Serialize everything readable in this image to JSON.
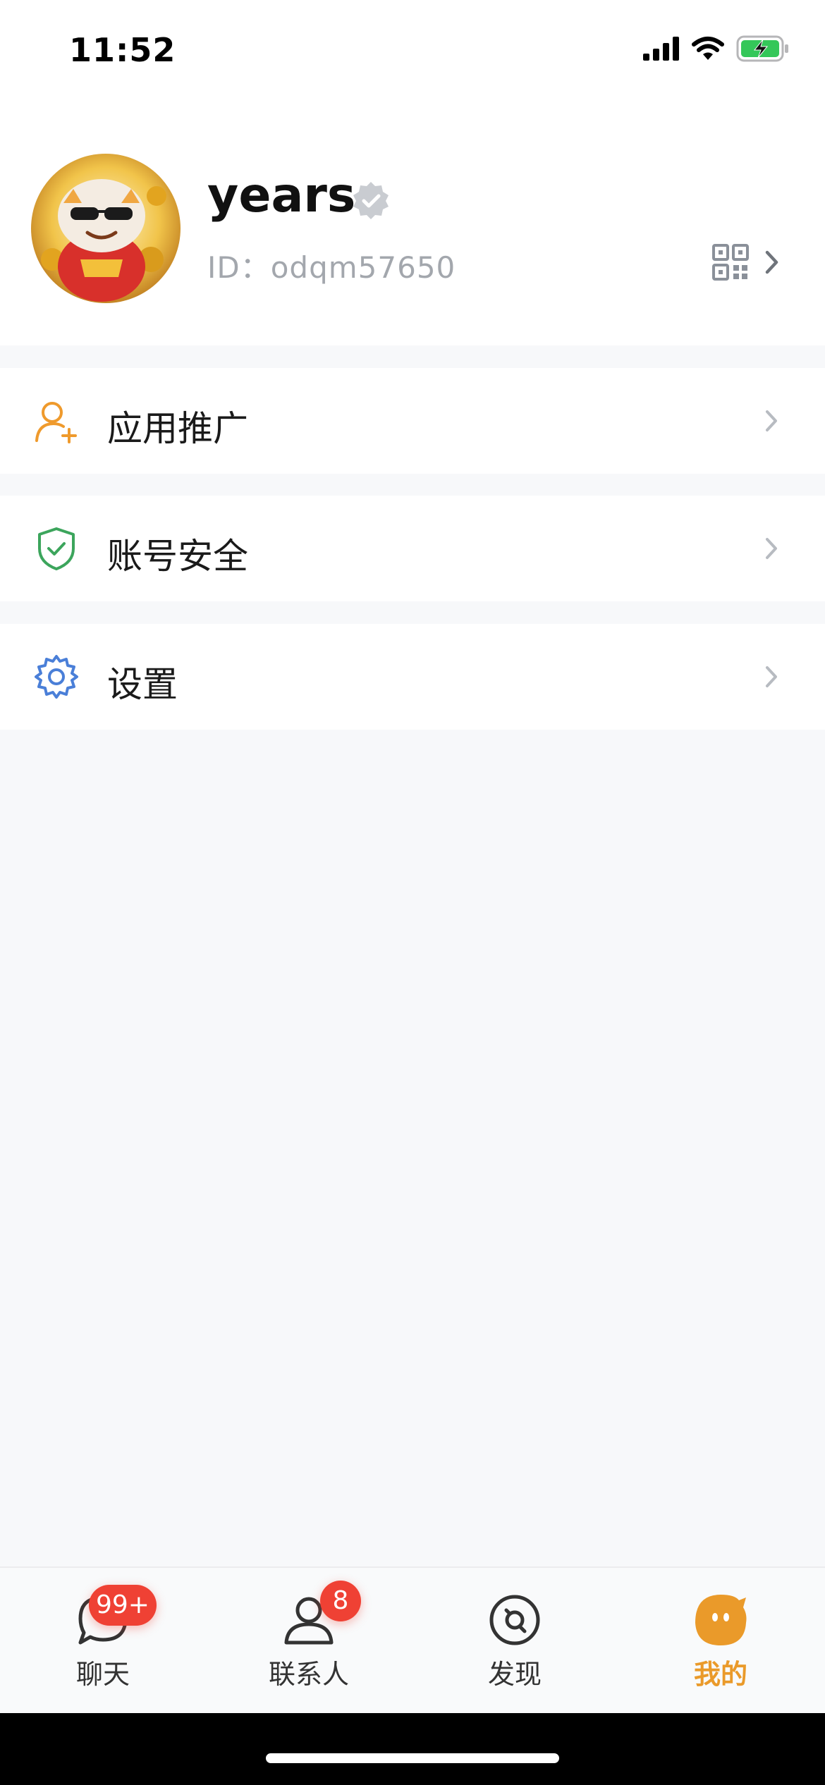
{
  "status_bar": {
    "time": "11:52",
    "icons": [
      "cellular-signal-icon",
      "wifi-icon",
      "battery-charging-icon"
    ],
    "battery_color": "#34c759"
  },
  "profile": {
    "username": "years",
    "user_id": "ID：odqm57650",
    "verified_icon": "verified-badge-icon",
    "qr_icon": "qr-code-icon"
  },
  "menu": [
    {
      "label": "应用推广",
      "icon": "add-user-icon",
      "color": "#ef9a2c"
    },
    {
      "label": "账号安全",
      "icon": "shield-check-icon",
      "color": "#3ca55c"
    },
    {
      "label": "设置",
      "icon": "gear-icon",
      "color": "#4a7fd8"
    }
  ],
  "tabbar": {
    "tabs": [
      {
        "label": "聊天",
        "badge": "99+",
        "icon": "chat-icon"
      },
      {
        "label": "联系人",
        "badge": "8",
        "icon": "contacts-icon"
      },
      {
        "label": "发现",
        "badge": "",
        "icon": "discover-icon"
      },
      {
        "label": "我的",
        "badge": "",
        "icon": "me-icon",
        "active": true
      }
    ],
    "active_color": "#ea9a2a",
    "badge_color": "#ef4134"
  }
}
